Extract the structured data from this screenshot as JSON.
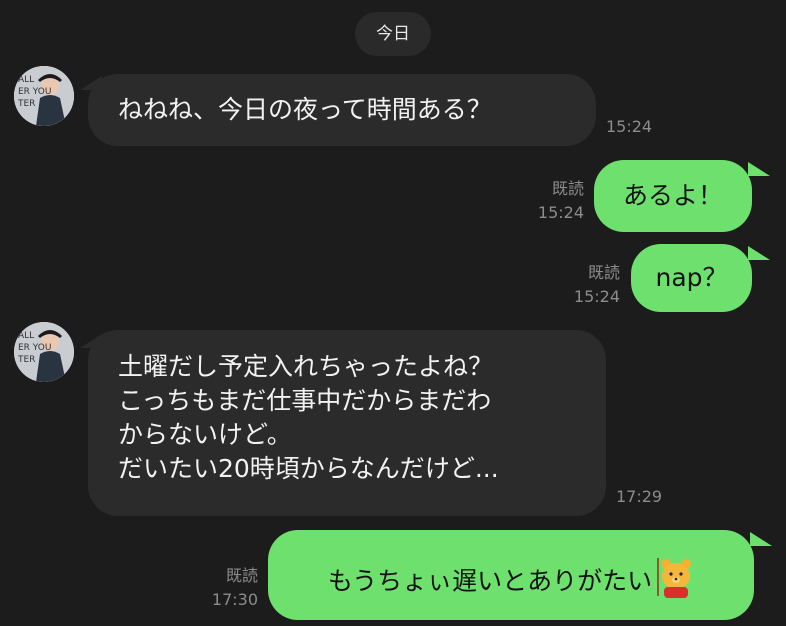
{
  "date_divider": "今日",
  "messages": [
    {
      "sender": "them",
      "text": "ねねね、今日の夜って時間ある？",
      "time": "15:24"
    },
    {
      "sender": "me",
      "text": "あるよ！",
      "read_label": "既読",
      "time": "15:24"
    },
    {
      "sender": "me",
      "text": "nap？",
      "read_label": "既読",
      "time": "15:24"
    },
    {
      "sender": "them",
      "lines": [
        "土曜だし予定入れちゃったよね？",
        "こっちもまだ仕事中だからまだわ",
        "からないけど。",
        "だいたい20時頃からなんだけど..."
      ],
      "time": "17:29"
    },
    {
      "sender": "me",
      "text": "もうちょぃ遅いとありがたい",
      "read_label": "既読",
      "time": "17:30",
      "sticker": "bear-icon"
    }
  ],
  "colors": {
    "background": "#1c1c1c",
    "incoming_bubble": "#2b2b2b",
    "outgoing_bubble": "#6ee06e",
    "meta_text": "#8c8c8c"
  }
}
